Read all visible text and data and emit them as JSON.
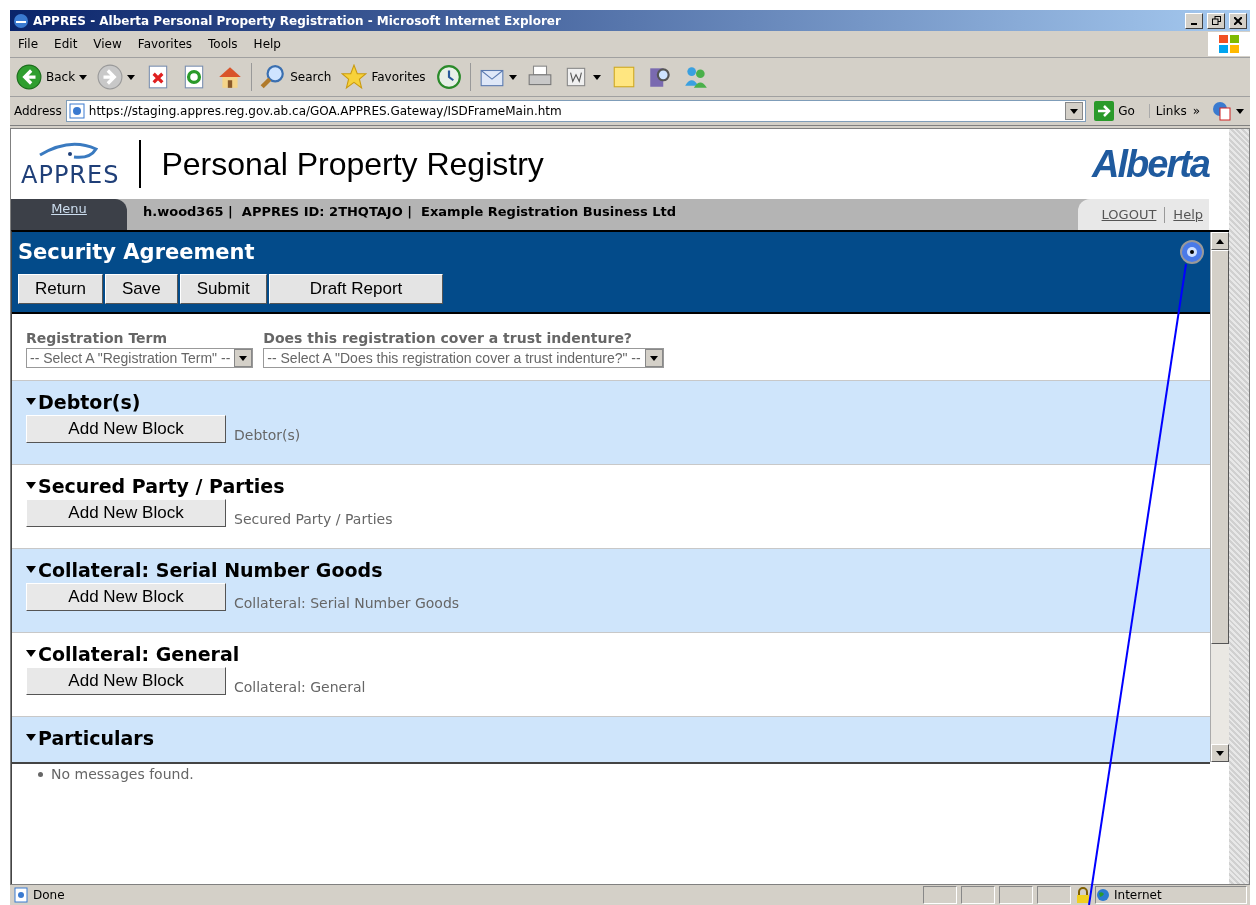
{
  "window": {
    "title": "APPRES - Alberta Personal Property Registration - Microsoft Internet Explorer"
  },
  "menu_bar": [
    "File",
    "Edit",
    "View",
    "Favorites",
    "Tools",
    "Help"
  ],
  "toolbar": [
    {
      "kind": "back",
      "label": "Back"
    },
    {
      "kind": "forward"
    },
    {
      "kind": "stop"
    },
    {
      "kind": "refresh"
    },
    {
      "kind": "home"
    },
    {
      "kind": "search",
      "label": "Search"
    },
    {
      "kind": "favorites",
      "label": "Favorites"
    },
    {
      "kind": "history"
    },
    {
      "kind": "mail"
    },
    {
      "kind": "print"
    },
    {
      "kind": "edit"
    },
    {
      "kind": "note"
    },
    {
      "kind": "research"
    },
    {
      "kind": "messenger"
    }
  ],
  "address_bar": {
    "label": "Address",
    "url": "https://staging.appres.reg.gov.ab.ca/GOA.APPRES.Gateway/ISDFrameMain.htm",
    "go": "Go",
    "links": "Links",
    "chevron": "»"
  },
  "page": {
    "logo": "APPRES",
    "title": "Personal Property Registry",
    "brand": "Alberta",
    "menu_tab": "Menu",
    "user_info": "h.wood365 |  APPRES ID: 2THQTAJO |  Example Registration Business Ltd",
    "links": [
      "LOGOUT",
      "Help"
    ],
    "panel_title": "Security Agreement",
    "actions": [
      "Return",
      "Save",
      "Submit",
      "Draft Report"
    ],
    "fields": [
      {
        "label": "Registration Term",
        "value": "-- Select A \"Registration Term\" --"
      },
      {
        "label": "Does this registration cover a trust indenture?",
        "value": "-- Select A \"Does this registration cover a trust indenture?\" --"
      }
    ],
    "sections": [
      {
        "title": "Debtor(s)",
        "button": "Add New Block",
        "caption": "Debtor(s)"
      },
      {
        "title": "Secured Party / Parties",
        "button": "Add New Block",
        "caption": "Secured Party / Parties"
      },
      {
        "title": "Collateral: Serial Number Goods",
        "button": "Add New Block",
        "caption": "Collateral: Serial Number Goods"
      },
      {
        "title": "Collateral: General",
        "button": "Add New Block",
        "caption": "Collateral: General"
      },
      {
        "title": "Particulars"
      }
    ],
    "messages": [
      "No messages found."
    ]
  },
  "status_bar": {
    "text": "Done",
    "zone": "Internet"
  }
}
